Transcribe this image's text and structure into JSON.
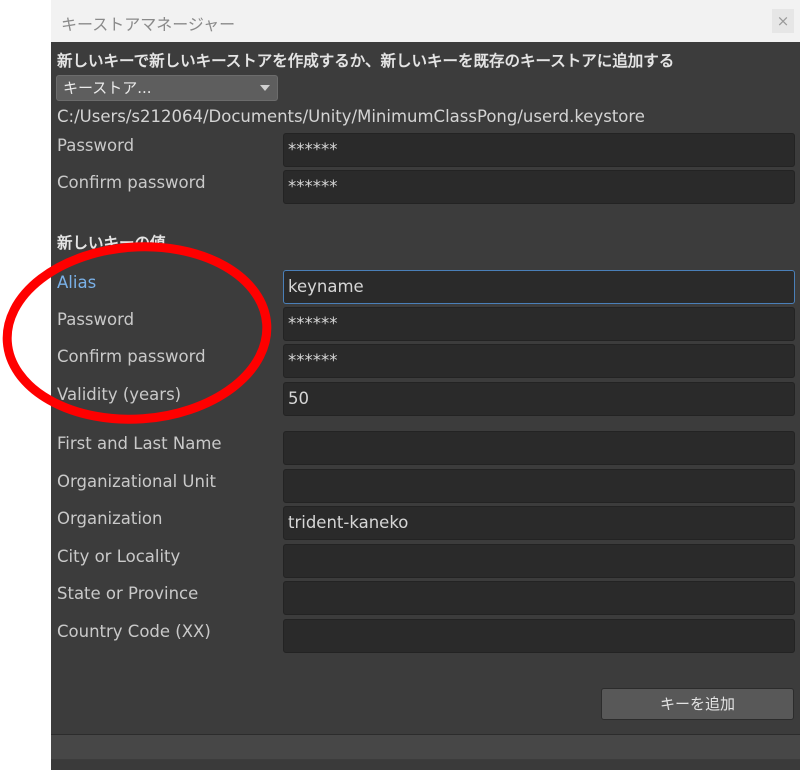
{
  "window": {
    "title": "キーストアマネージャー",
    "close_glyph": "×"
  },
  "keystore_section": {
    "heading": "新しいキーで新しいキーストアを作成するか、新しいキーを既存のキーストアに追加する",
    "dropdown_value": "キーストア...",
    "path": "C:/Users/s212064/Documents/Unity/MinimumClassPong/userd.keystore",
    "password_label": "Password",
    "password_value": "******",
    "confirm_label": "Confirm password",
    "confirm_value": "******"
  },
  "new_key": {
    "heading": "新しいキーの値",
    "alias_label": "Alias",
    "alias_value": "keyname",
    "password_label": "Password",
    "password_value": "******",
    "confirm_label": "Confirm password",
    "confirm_value": "******",
    "validity_label": "Validity (years)",
    "validity_value": "50",
    "name_label": "First and Last Name",
    "name_value": "",
    "unit_label": "Organizational Unit",
    "unit_value": "",
    "org_label": "Organization",
    "org_value": "trident-kaneko",
    "city_label": "City or Locality",
    "city_value": "",
    "state_label": "State or Province",
    "state_value": "",
    "country_label": "Country Code (XX)",
    "country_value": ""
  },
  "actions": {
    "add_key_label": "キーを追加"
  },
  "colors": {
    "annotation_circle": "#ff0000",
    "alias_label_active": "#7ab1e8",
    "focus_border": "#4a7fb8"
  }
}
